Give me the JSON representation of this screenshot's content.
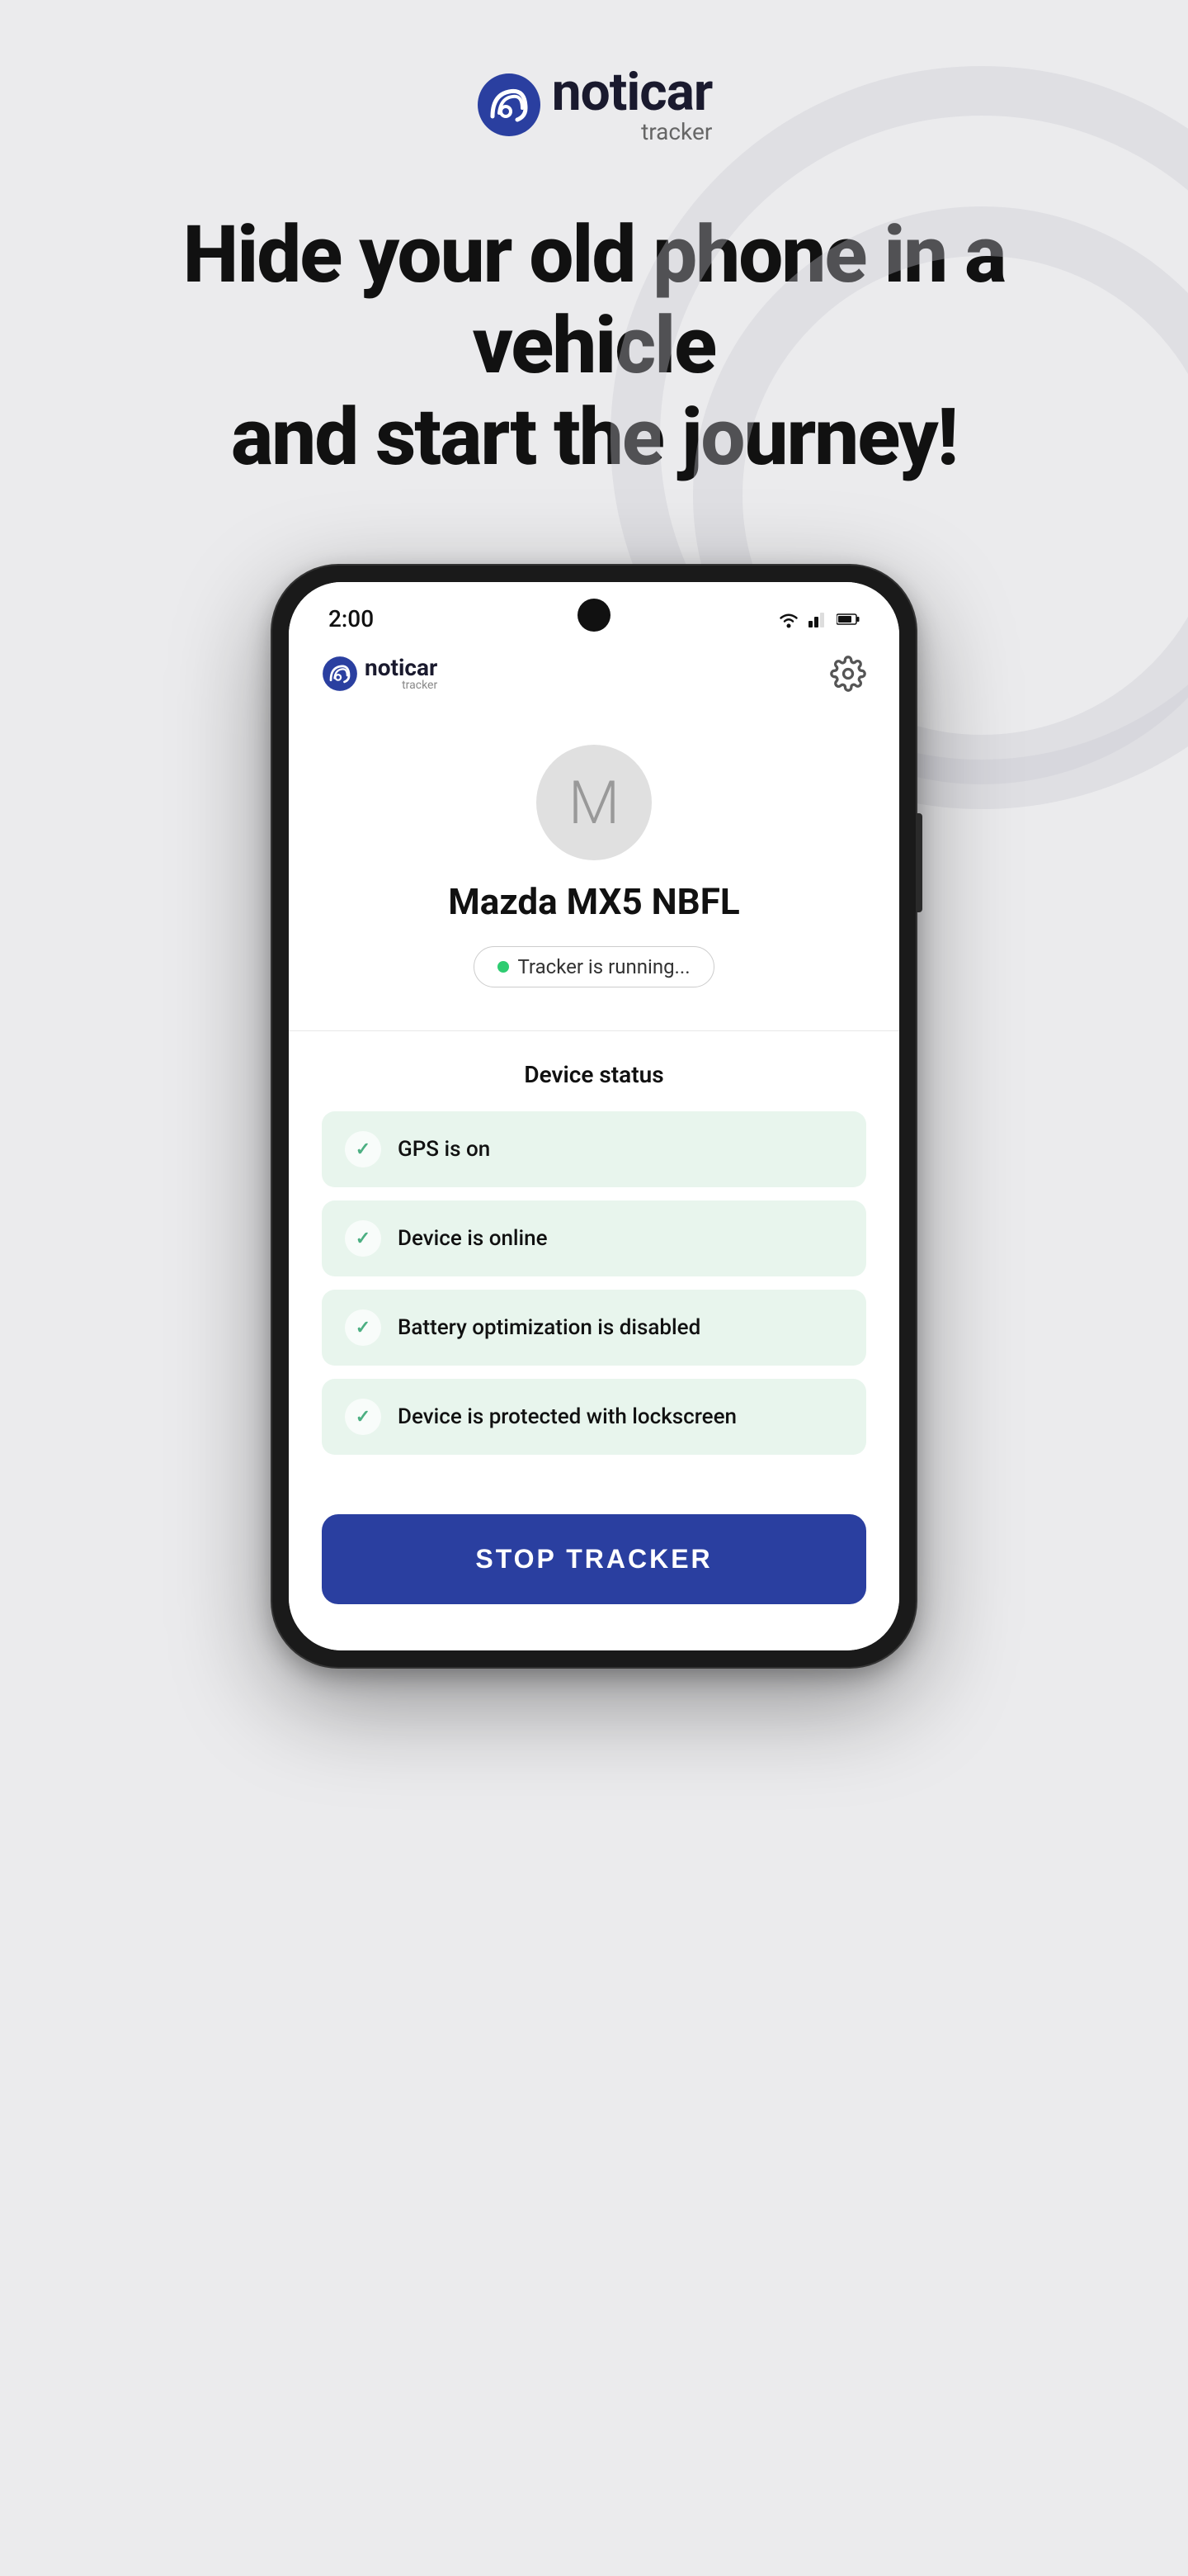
{
  "background": {
    "color": "#ebebed"
  },
  "page_logo": {
    "icon_label": "noticar-logo-icon",
    "brand": "noticar",
    "sub": "tracker"
  },
  "hero": {
    "line1": "Hide your old phone in a vehicle",
    "line2": "and start the journey!"
  },
  "phone": {
    "status_bar": {
      "time": "2:00",
      "wifi_icon": "wifi-icon",
      "signal_icon": "signal-icon",
      "battery_icon": "battery-icon"
    },
    "app_header": {
      "logo_brand": "noticar",
      "logo_sub": "tracker",
      "settings_icon": "gear-icon"
    },
    "profile": {
      "avatar_letter": "M",
      "vehicle_name": "Mazda MX5 NBFL",
      "tracker_status": "Tracker is running..."
    },
    "device_status": {
      "section_title": "Device status",
      "items": [
        {
          "label": "GPS is on"
        },
        {
          "label": "Device is online"
        },
        {
          "label": "Battery optimization is disabled"
        },
        {
          "label": "Device is protected with lockscreen"
        }
      ]
    },
    "stop_button": {
      "label": "STOP TRACKER"
    }
  }
}
